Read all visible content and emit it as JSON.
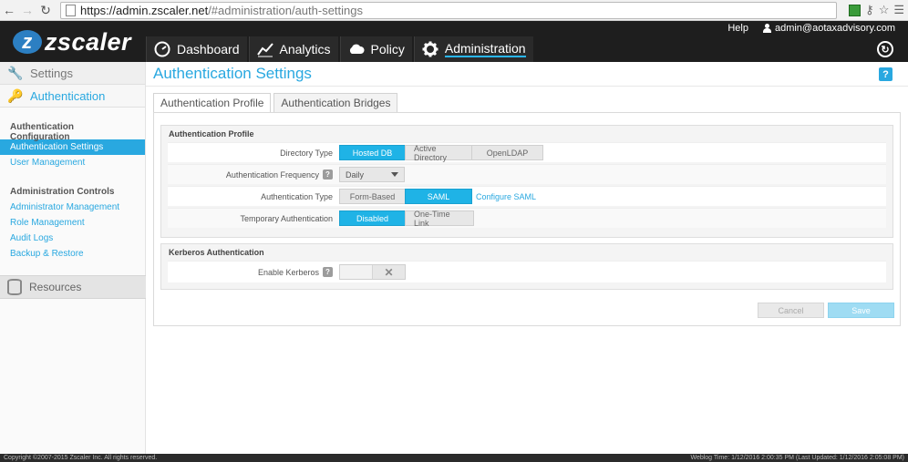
{
  "browser": {
    "url_host": "https://admin.zscaler.net",
    "url_path": "/#administration/auth-settings"
  },
  "header": {
    "logo_text": "zscaler",
    "help_label": "Help",
    "user_email": "admin@aotaxadvisory.com",
    "nav": [
      {
        "label": "Dashboard",
        "icon": "dashboard-icon"
      },
      {
        "label": "Analytics",
        "icon": "analytics-icon"
      },
      {
        "label": "Policy",
        "icon": "cloud-icon"
      },
      {
        "label": "Administration",
        "icon": "gear-icon",
        "active": true
      }
    ]
  },
  "sidebar": {
    "settings_label": "Settings",
    "authentication_label": "Authentication",
    "sections": [
      {
        "title": "Authentication Configuration",
        "links": [
          "Authentication Settings",
          "User Management"
        ]
      },
      {
        "title": "Administration Controls",
        "links": [
          "Administrator Management",
          "Role Management",
          "Audit Logs",
          "Backup & Restore"
        ]
      }
    ],
    "resources_label": "Resources"
  },
  "main": {
    "title": "Authentication Settings",
    "help_icon": "?",
    "tabs": [
      "Authentication Profile",
      "Authentication Bridges"
    ],
    "profile_group": {
      "title": "Authentication Profile",
      "directory_type": {
        "label": "Directory Type",
        "options": [
          "Hosted DB",
          "Active Directory",
          "OpenLDAP"
        ],
        "selected": "Hosted DB"
      },
      "auth_frequency": {
        "label": "Authentication Frequency",
        "value": "Daily"
      },
      "auth_type": {
        "label": "Authentication Type",
        "options": [
          "Form-Based",
          "SAML"
        ],
        "selected": "SAML",
        "link": "Configure SAML"
      },
      "temp_auth": {
        "label": "Temporary Authentication",
        "options": [
          "Disabled",
          "One-Time Link"
        ],
        "selected": "Disabled"
      }
    },
    "kerberos_group": {
      "title": "Kerberos Authentication",
      "enable_label": "Enable Kerberos",
      "enabled": false
    },
    "cancel_label": "Cancel",
    "save_label": "Save"
  },
  "footer": {
    "copyright": "Copyright ©2007-2015 Zscaler Inc. All rights reserved.",
    "weblog": "Weblog Time: 1/12/2016 2:00:35 PM (Last Updated: 1/12/2016 2:05:08 PM)"
  },
  "colors": {
    "accent": "#29a8e0",
    "selected_segment": "#1fb3e6",
    "header_bg": "#1e1e1e"
  }
}
